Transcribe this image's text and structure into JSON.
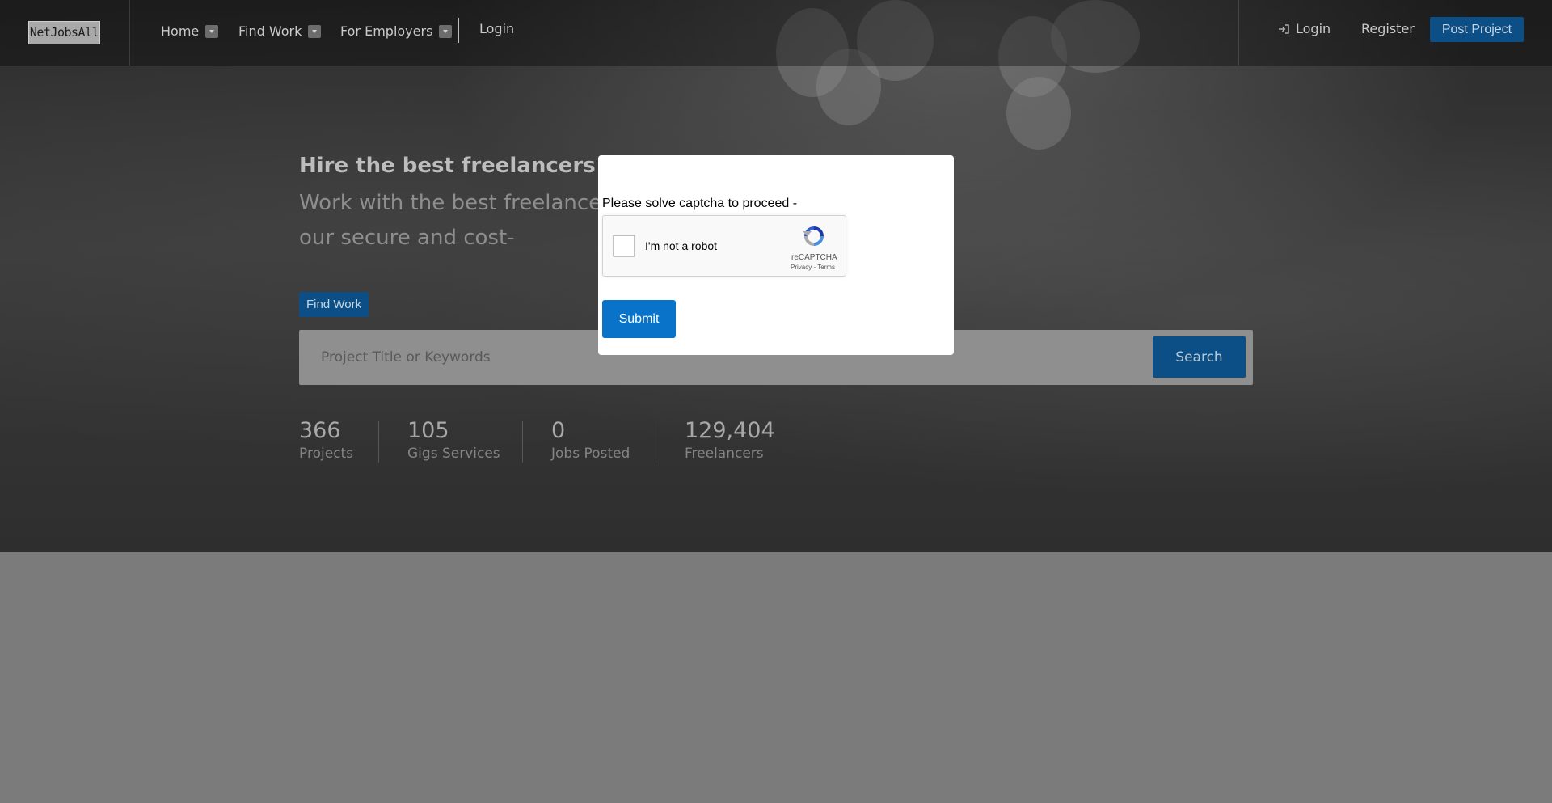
{
  "brand": {
    "logo_text": "NetJobsAll"
  },
  "nav": {
    "items": [
      {
        "label": "Home"
      },
      {
        "label": "Find Work"
      },
      {
        "label": "For Employers"
      }
    ],
    "login_label": "Login"
  },
  "header_right": {
    "login_label": "Login",
    "register_label": "Register",
    "post_project_label": "Post Project"
  },
  "hero": {
    "title": "Hire the best freelancers for a",
    "subtitle": "Work with the best freelance t world on our secure and cost-",
    "find_work_label": "Find Work",
    "search_placeholder": "Project Title or Keywords",
    "search_button_label": "Search"
  },
  "stats": [
    {
      "value": "366",
      "label": "Projects"
    },
    {
      "value": "105",
      "label": "Gigs Services"
    },
    {
      "value": "0",
      "label": "Jobs Posted"
    },
    {
      "value": "129,404",
      "label": "Freelancers"
    }
  ],
  "modal": {
    "prompt": "Please solve captcha to proceed -",
    "captcha_label": "I'm not a robot",
    "captcha_brand": "reCAPTCHA",
    "captcha_links": "Privacy - Terms",
    "submit_label": "Submit"
  },
  "colors": {
    "accent": "#0873c8",
    "accent_dimmed": "#0b4f86",
    "overlay": "#7b7b7b"
  }
}
